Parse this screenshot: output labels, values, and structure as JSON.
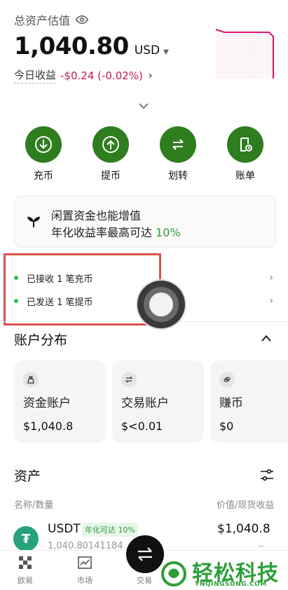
{
  "header": {
    "label": "总资产估值",
    "balance": "1,040.80",
    "currency": "USD",
    "today_label": "今日收益",
    "today_pnl": "-$0.24 (-0.02%)"
  },
  "actions": [
    {
      "label": "充币",
      "icon": "deposit-icon"
    },
    {
      "label": "提币",
      "icon": "withdraw-icon"
    },
    {
      "label": "划转",
      "icon": "transfer-icon"
    },
    {
      "label": "账单",
      "icon": "bill-icon"
    }
  ],
  "promo": {
    "line1": "闲置资金也能增值",
    "line2_prefix": "年化收益率最高可达 ",
    "line2_rate": "10%"
  },
  "notices": [
    {
      "text": "已接收 1 笔充币"
    },
    {
      "text": "已发送 1 笔提币"
    }
  ],
  "distribution": {
    "title": "账户分布",
    "accounts": [
      {
        "name": "资金账户",
        "value": "$1,040.8",
        "icon": "fund-bag-icon"
      },
      {
        "name": "交易账户",
        "value": "$<0.01",
        "icon": "swap-icon"
      },
      {
        "name": "赚币",
        "value": "$0",
        "icon": "coins-icon"
      }
    ]
  },
  "assets": {
    "title": "资产",
    "col_left": "名称/数量",
    "col_right": "价值/现货收益",
    "rows": [
      {
        "symbol": "USDT",
        "badge": "年化可达 10%",
        "qty": "1,040.80141184",
        "value": "$1,040.8",
        "earn": "--"
      }
    ]
  },
  "tabbar": {
    "items": [
      {
        "label": "欧易"
      },
      {
        "label": "市场"
      },
      {
        "label": "交易"
      }
    ]
  },
  "watermark": {
    "main": "轻松科技",
    "sub": "YNQINGSONG.COM"
  },
  "colors": {
    "brand_green": "#2e7d1e",
    "negative": "#c2185b",
    "highlight_green": "#2e9d3a"
  }
}
